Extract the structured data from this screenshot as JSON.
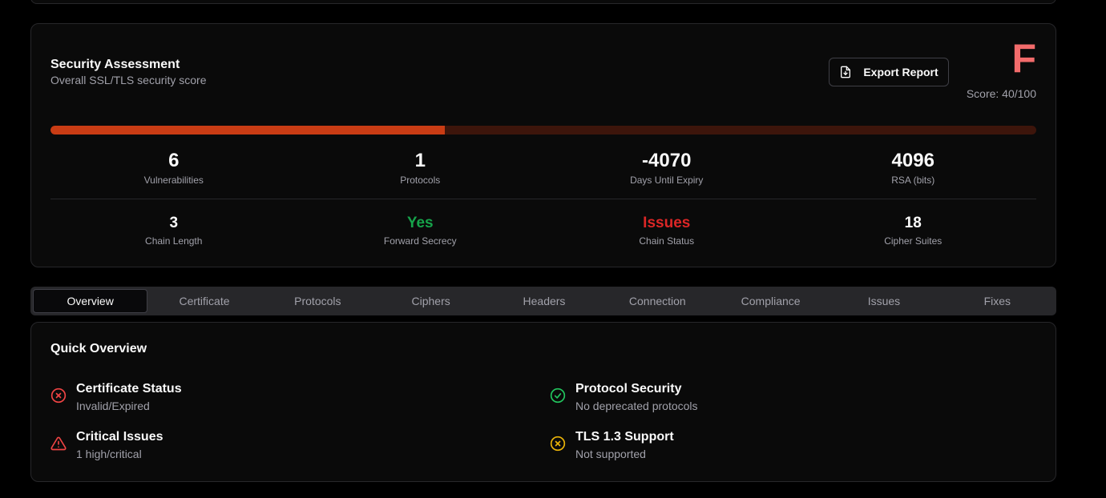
{
  "assessment": {
    "title": "Security Assessment",
    "subtitle": "Overall SSL/TLS security score",
    "export_label": "Export Report",
    "grade": "F",
    "score_text": "Score: 40/100",
    "score_fraction": 0.4,
    "stats_row1": [
      {
        "value": "6",
        "label": "Vulnerabilities"
      },
      {
        "value": "1",
        "label": "Protocols"
      },
      {
        "value": "-4070",
        "label": "Days Until Expiry"
      },
      {
        "value": "4096",
        "label": "RSA (bits)"
      }
    ],
    "stats_row2": [
      {
        "value": "3",
        "label": "Chain Length"
      },
      {
        "value": "Yes",
        "label": "Forward Secrecy"
      },
      {
        "value": "Issues",
        "label": "Chain Status"
      },
      {
        "value": "18",
        "label": "Cipher Suites"
      }
    ],
    "colors": {
      "grade": "#f26b6b",
      "progress": "#c93c14",
      "good": "#16a34a",
      "bad": "#dc2626"
    }
  },
  "tabs": [
    "Overview",
    "Certificate",
    "Protocols",
    "Ciphers",
    "Headers",
    "Connection",
    "Compliance",
    "Issues",
    "Fixes"
  ],
  "active_tab": "Overview",
  "overview": {
    "title": "Quick Overview",
    "items": [
      {
        "icon": "x-circle-icon",
        "title": "Certificate Status",
        "sub": "Invalid/Expired"
      },
      {
        "icon": "check-circle-icon",
        "title": "Protocol Security",
        "sub": "No deprecated protocols"
      },
      {
        "icon": "warning-triangle-icon",
        "title": "Critical Issues",
        "sub": "1 high/critical"
      },
      {
        "icon": "x-circle-icon",
        "title": "TLS 1.3 Support",
        "sub": "Not supported"
      }
    ]
  }
}
